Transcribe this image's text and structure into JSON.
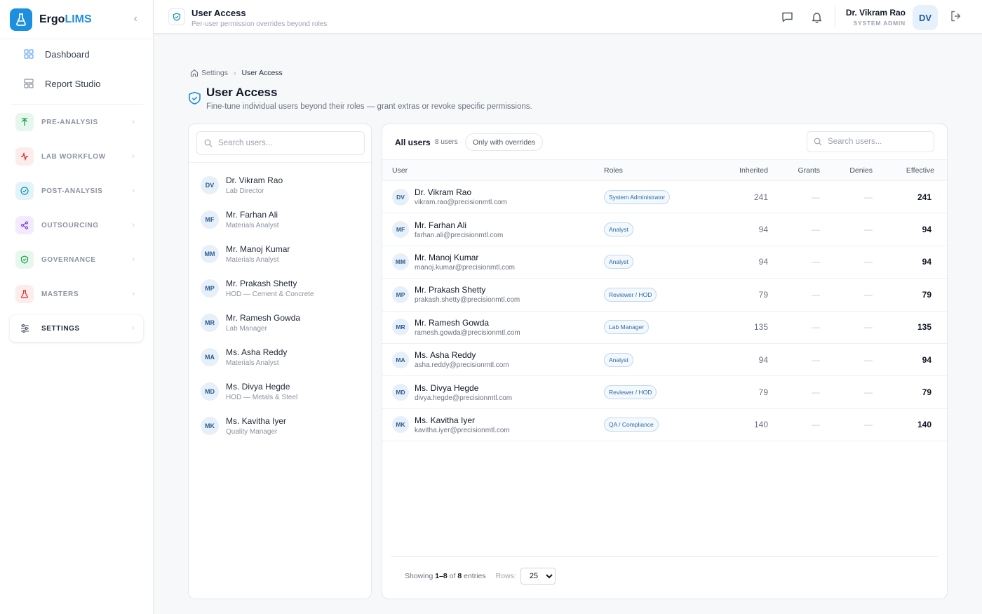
{
  "brand": {
    "name_main": "Ergo",
    "name_accent": "LIMS"
  },
  "sidebar": {
    "plain_items": [
      {
        "label": "Dashboard",
        "icon": "grid-icon"
      },
      {
        "label": "Report Studio",
        "icon": "layout-icon"
      }
    ],
    "groups": [
      {
        "label": "PRE-ANALYSIS",
        "icon": "arrow-up-icon",
        "color": "#16a34a",
        "bg": "#e8f7ee"
      },
      {
        "label": "LAB WORKFLOW",
        "icon": "activity-icon",
        "color": "#dc2626",
        "bg": "#fdecec"
      },
      {
        "label": "POST-ANALYSIS",
        "icon": "check-circle-icon",
        "color": "#0e8fb0",
        "bg": "#e3f4f8"
      },
      {
        "label": "OUTSOURCING",
        "icon": "share-icon",
        "color": "#7c3aed",
        "bg": "#f1ebfd"
      },
      {
        "label": "GOVERNANCE",
        "icon": "shield-icon",
        "color": "#16a34a",
        "bg": "#e8f7ee"
      },
      {
        "label": "MASTERS",
        "icon": "flask-icon",
        "color": "#dc2626",
        "bg": "#fdecec"
      },
      {
        "label": "SETTINGS",
        "icon": "sliders-icon",
        "color": "#4b5563",
        "bg": "#f3f4f6",
        "active": true
      }
    ]
  },
  "topbar": {
    "title": "User Access",
    "subtitle": "Per-user permission overrides beyond roles",
    "user_name": "Dr. Vikram Rao",
    "user_role": "SYSTEM ADMIN",
    "user_initials": "DV"
  },
  "page": {
    "breadcrumb_root": "Settings",
    "breadcrumb_current": "User Access",
    "title": "User Access",
    "subtitle": "Fine-tune individual users beyond their roles — grant extras or revoke specific permissions."
  },
  "left_panel": {
    "search_placeholder": "Search users...",
    "users": [
      {
        "initials": "DV",
        "name": "Dr. Vikram Rao",
        "subtitle": "Lab Director"
      },
      {
        "initials": "MF",
        "name": "Mr. Farhan Ali",
        "subtitle": "Materials Analyst"
      },
      {
        "initials": "MM",
        "name": "Mr. Manoj Kumar",
        "subtitle": "Materials Analyst"
      },
      {
        "initials": "MP",
        "name": "Mr. Prakash Shetty",
        "subtitle": "HOD — Cement & Concrete"
      },
      {
        "initials": "MR",
        "name": "Mr. Ramesh Gowda",
        "subtitle": "Lab Manager"
      },
      {
        "initials": "MA",
        "name": "Ms. Asha Reddy",
        "subtitle": "Materials Analyst"
      },
      {
        "initials": "MD",
        "name": "Ms. Divya Hegde",
        "subtitle": "HOD — Metals & Steel"
      },
      {
        "initials": "MK",
        "name": "Ms. Kavitha Iyer",
        "subtitle": "Quality Manager"
      }
    ]
  },
  "right_panel": {
    "all_label": "All users",
    "count_label": "8 users",
    "filter_chip": "Only with overrides",
    "search_placeholder": "Search users...",
    "columns": {
      "user": "User",
      "roles": "Roles",
      "inherited": "Inherited",
      "grants": "Grants",
      "denies": "Denies",
      "effective": "Effective"
    },
    "rows": [
      {
        "initials": "DV",
        "name": "Dr. Vikram Rao",
        "email": "vikram.rao@precisionmtl.com",
        "role": "System Administrator",
        "inherited": "241",
        "grants": "—",
        "denies": "—",
        "effective": "241"
      },
      {
        "initials": "MF",
        "name": "Mr. Farhan Ali",
        "email": "farhan.ali@precisionmtl.com",
        "role": "Analyst",
        "inherited": "94",
        "grants": "—",
        "denies": "—",
        "effective": "94"
      },
      {
        "initials": "MM",
        "name": "Mr. Manoj Kumar",
        "email": "manoj.kumar@precisionmtl.com",
        "role": "Analyst",
        "inherited": "94",
        "grants": "—",
        "denies": "—",
        "effective": "94"
      },
      {
        "initials": "MP",
        "name": "Mr. Prakash Shetty",
        "email": "prakash.shetty@precisionmtl.com",
        "role": "Reviewer / HOD",
        "inherited": "79",
        "grants": "—",
        "denies": "—",
        "effective": "79"
      },
      {
        "initials": "MR",
        "name": "Mr. Ramesh Gowda",
        "email": "ramesh.gowda@precisionmtl.com",
        "role": "Lab Manager",
        "inherited": "135",
        "grants": "—",
        "denies": "—",
        "effective": "135"
      },
      {
        "initials": "MA",
        "name": "Ms. Asha Reddy",
        "email": "asha.reddy@precisionmtl.com",
        "role": "Analyst",
        "inherited": "94",
        "grants": "—",
        "denies": "—",
        "effective": "94"
      },
      {
        "initials": "MD",
        "name": "Ms. Divya Hegde",
        "email": "divya.hegde@precisionmtl.com",
        "role": "Reviewer / HOD",
        "inherited": "79",
        "grants": "—",
        "denies": "—",
        "effective": "79"
      },
      {
        "initials": "MK",
        "name": "Ms. Kavitha Iyer",
        "email": "kavitha.iyer@precisionmtl.com",
        "role": "QA / Compliance",
        "inherited": "140",
        "grants": "—",
        "denies": "—",
        "effective": "140"
      }
    ],
    "footer": {
      "showing_prefix": "Showing",
      "range": "1–8",
      "of": "of",
      "total": "8",
      "entries": "entries",
      "rows_label": "Rows:",
      "rows_value": "25"
    }
  }
}
